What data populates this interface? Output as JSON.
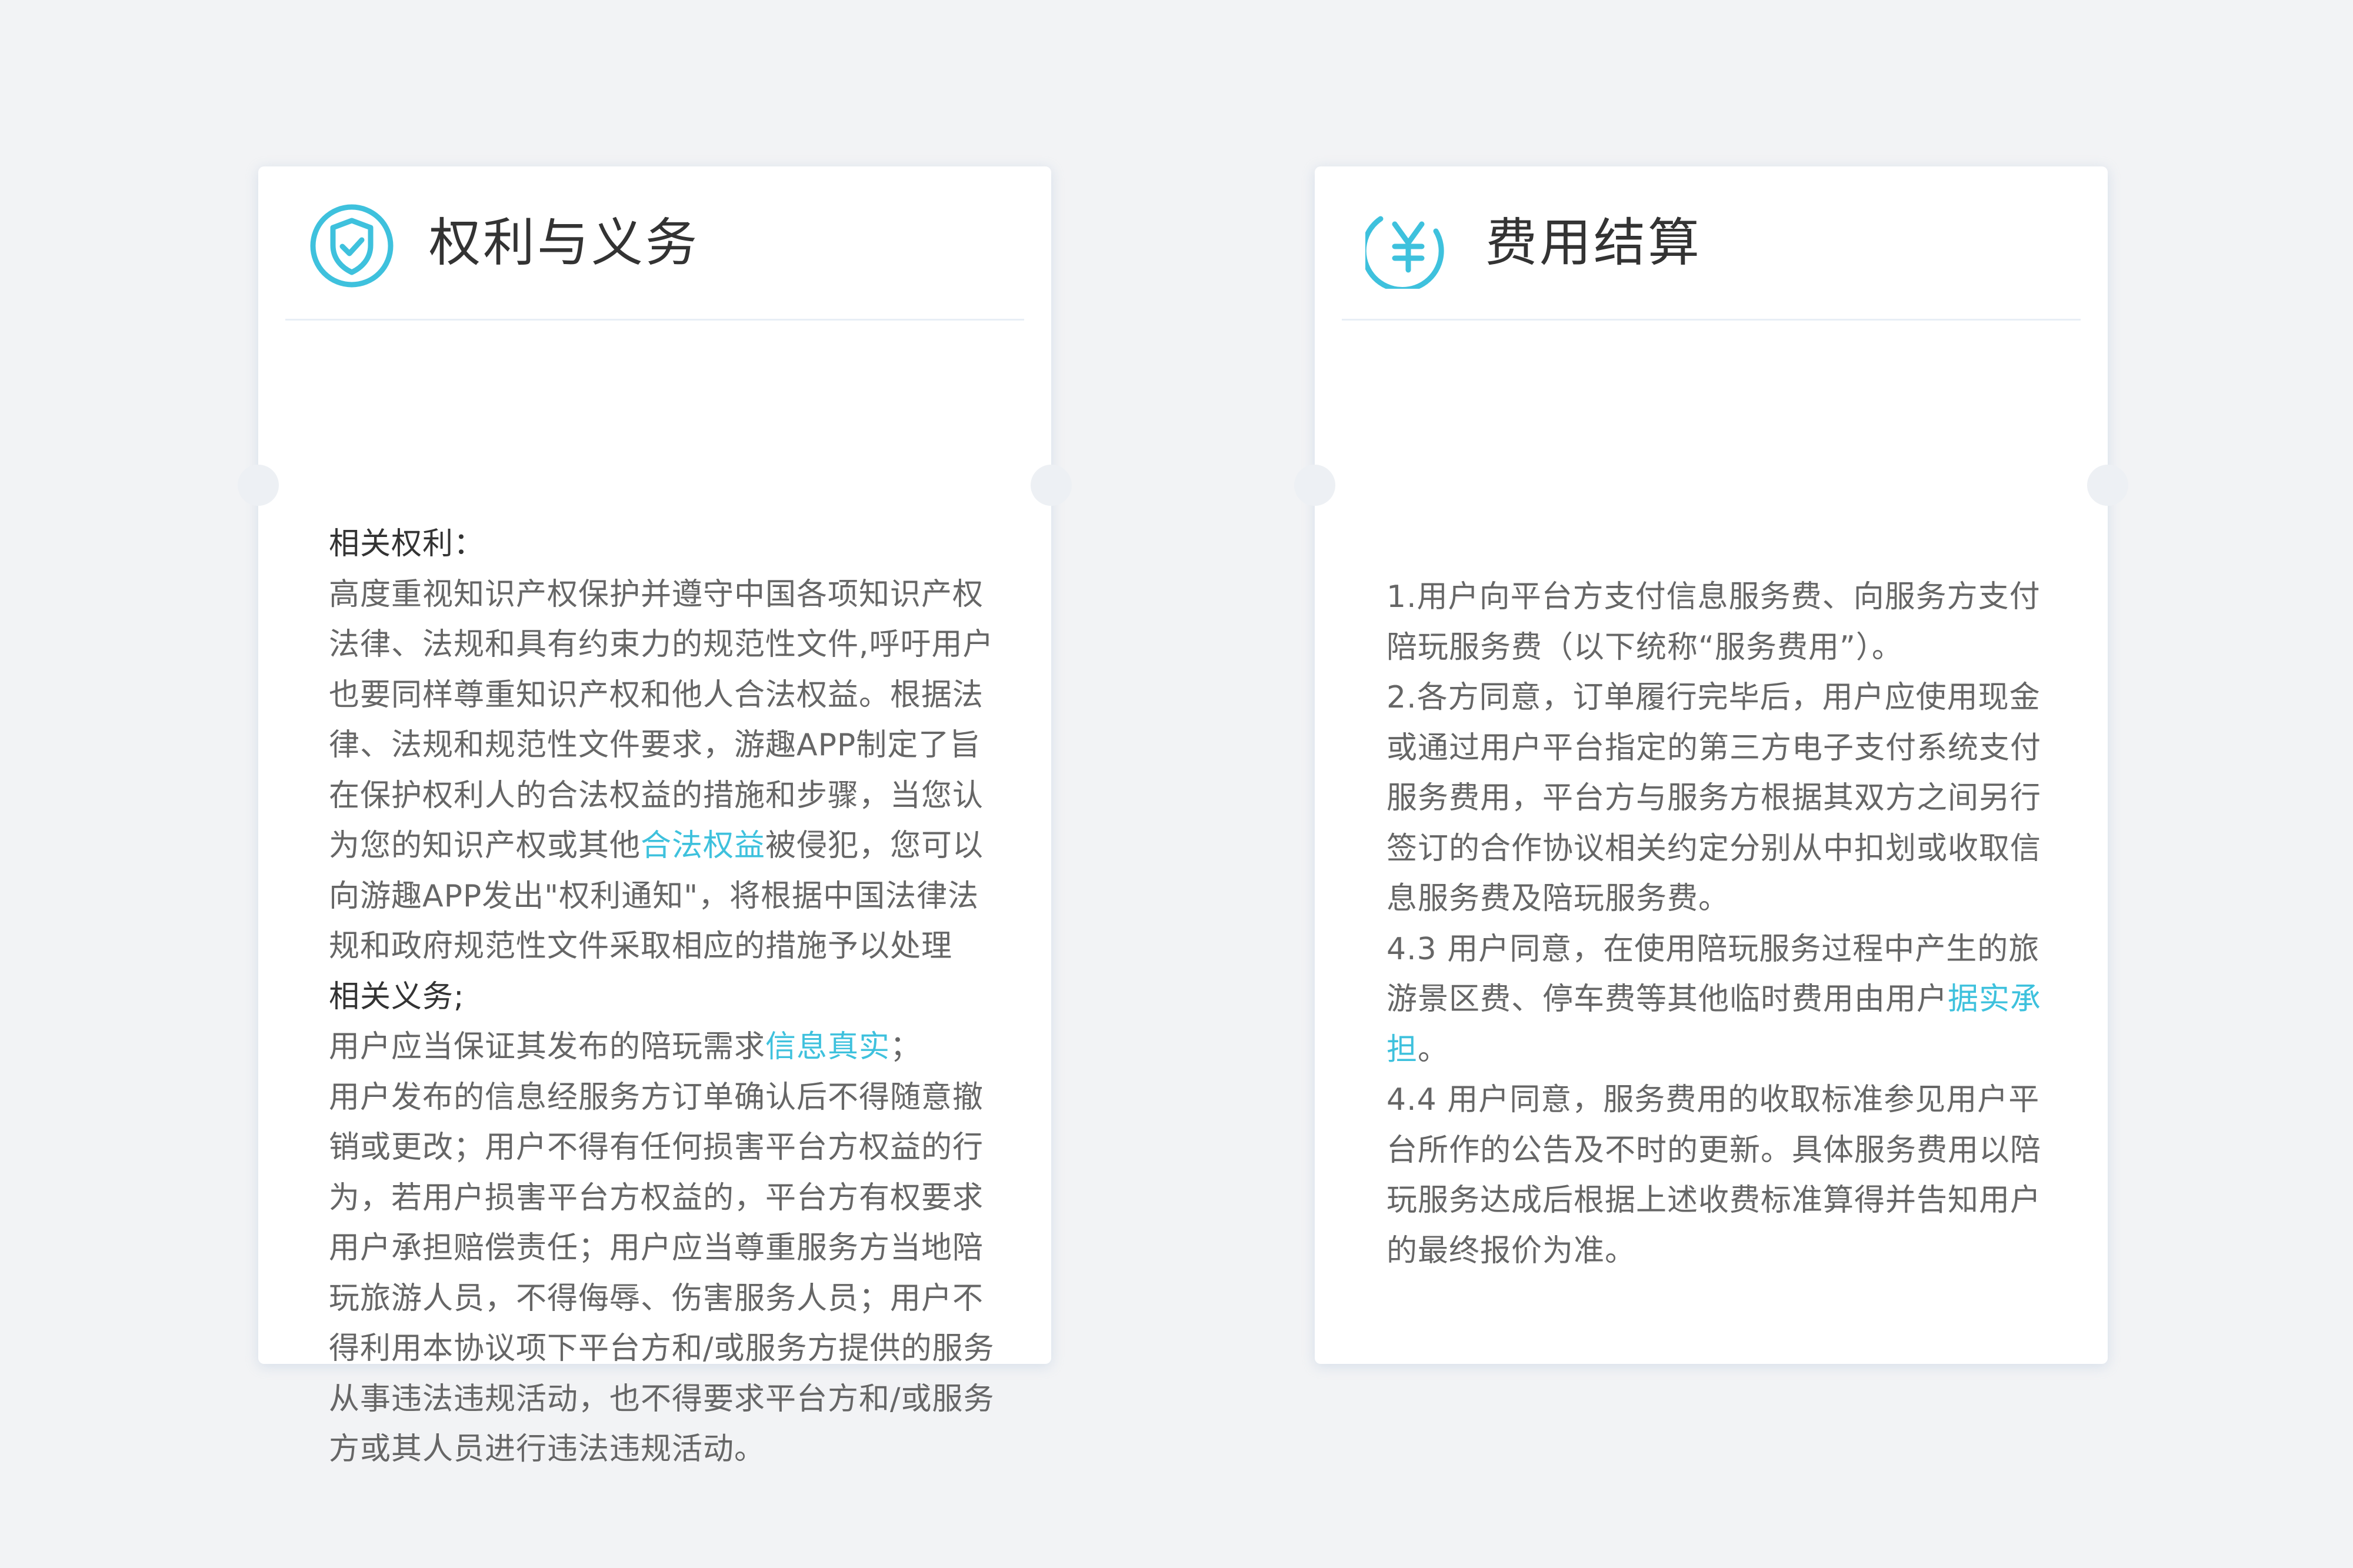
{
  "colors": {
    "accent": "#3ec1dd",
    "heading_text": "#333333",
    "body_text": "#666666",
    "background": "#f2f3f5",
    "card": "#ffffff"
  },
  "left_card": {
    "icon": "shield-check-icon",
    "title": "权利与义务",
    "rights_heading": "相关权利：",
    "rights_text_1": "高度重视知识产权保护并遵守中国各项知识产权法律、法规和具有约束力的规范性文件,呼吁用户也要同样尊重知识产权和他人合法权益。根据法律、法规和规范性文件要求，游趣APP制定了旨在保护权利人的合法权益的措施和步骤，当您认为您的知识产权或其他",
    "rights_link": "合法权益",
    "rights_text_2": "被侵犯，您可以向游趣APP发出\"权利通知\"，将根据中国法律法规和政府规范性文件采取相应的措施予以处理",
    "duties_heading": "相关义务;",
    "duties_text_1": "用户应当保证其发布的陪玩需求",
    "duties_link": "信息真实",
    "duties_text_1_end": "；",
    "duties_text_2": "用户发布的信息经服务方订单确认后不得随意撤销或更改；用户不得有任何损害平台方权益的行为，若用户损害平台方权益的，平台方有权要求用户承担赔偿责任；用户应当尊重服务方当地陪玩旅游人员，不得侮辱、伤害服务人员；用户不得利用本协议项下平台方和/或服务方提供的服务从事违法违规活动，也不得要求平台方和/或服务方或其人员进行违法违规活动。"
  },
  "right_card": {
    "icon": "yen-circle-icon",
    "title": "费用结算",
    "item_1": "1.用户向平台方支付信息服务费、向服务方支付陪玩服务费（以下统称“服务费用”）。",
    "item_2": "2.各方同意，订单履行完毕后，用户应使用现金或通过用户平台指定的第三方电子支付系统支付服务费用，平台方与服务方根据其双方之间另行签订的合作协议相关约定分别从中扣划或收取信息服务费及陪玩服务费。",
    "item_3_text": "4.3  用户同意，在使用陪玩服务过程中产生的旅游景区费、停车费等其他临时费用由用户",
    "item_3_link": "据实承担",
    "item_3_end": "。",
    "item_4": "4.4  用户同意，服务费用的收取标准参见用户平台所作的公告及不时的更新。具体服务费用以陪玩服务达成后根据上述收费标准算得并告知用户的最终报价为准。"
  }
}
